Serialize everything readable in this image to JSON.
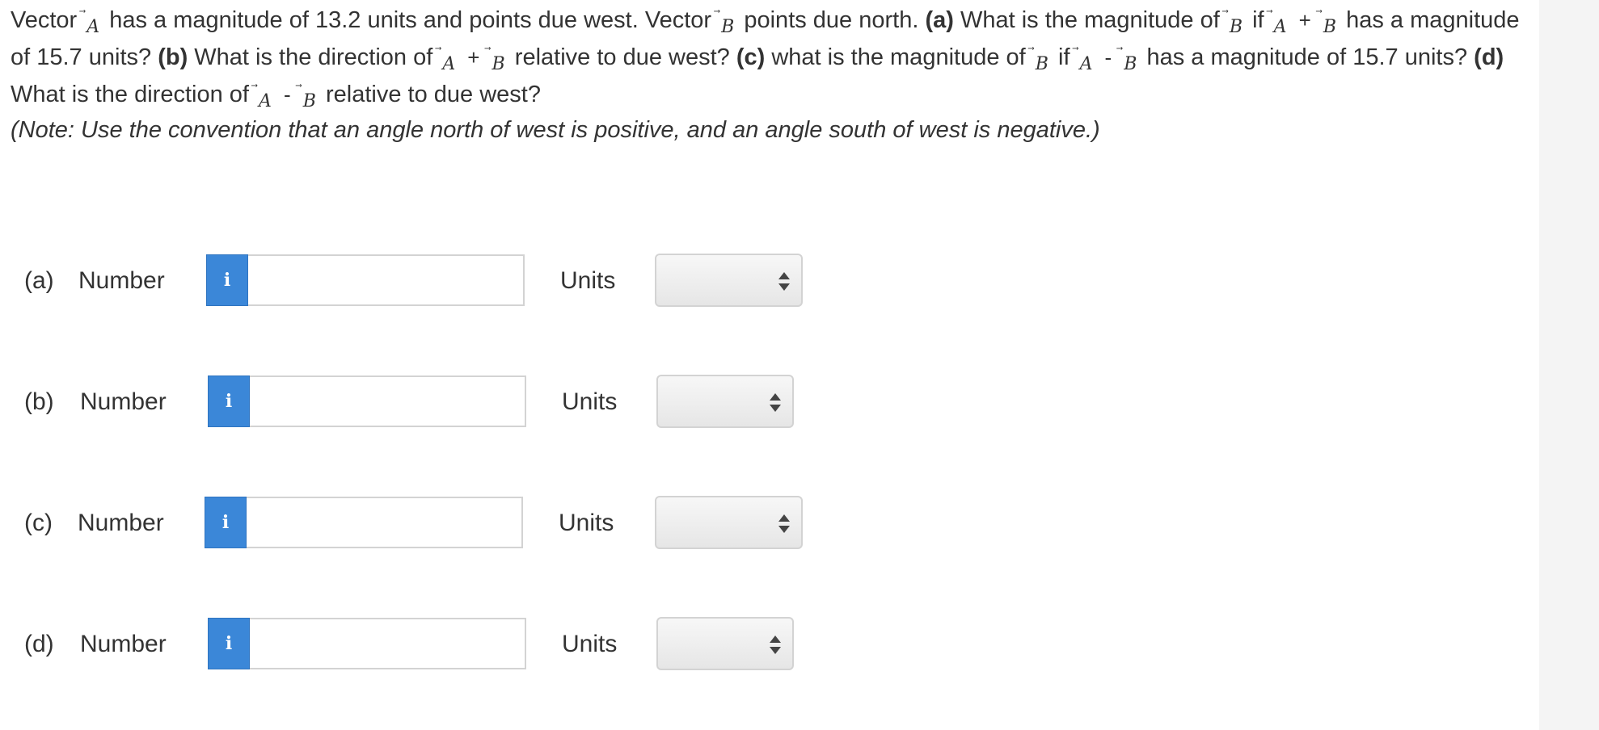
{
  "question": {
    "s1": "Vector",
    "s2": "has a magnitude of 13.2 units and points due west. Vector",
    "s3": "points due north.",
    "a_tag": "(a)",
    "a_text": "What is the magnitude of",
    "if_word": "if",
    "plus": "+",
    "has_a": "has a magnitude of 15.7 units?",
    "b_tag": "(b)",
    "b_text": "What is the direction of",
    "relative_west": "relative to due west?",
    "c_tag": "(c)",
    "c_text": "what is the magnitude of",
    "if_word_2": "if",
    "minus": "-",
    "has_a_2": "has a magnitude of 15.7 units?",
    "d_tag": "(d)",
    "d_text": "What is the direction of",
    "minus_2": "-",
    "relative_west_2": "relative to due west?",
    "vector_a": "A",
    "vector_b": "B",
    "arrow": "⃗"
  },
  "note": "(Note: Use the convention that an angle north of west is positive, and an angle south of west is negative.)",
  "parts": [
    {
      "tag": "(a)",
      "label": "Number",
      "info_icon": "i",
      "value": "",
      "units_label": "Units",
      "units_value": ""
    },
    {
      "tag": "(b)",
      "label": "Number",
      "info_icon": "i",
      "value": "",
      "units_label": "Units",
      "units_value": ""
    },
    {
      "tag": "(c)",
      "label": "Number",
      "info_icon": "i",
      "value": "",
      "units_label": "Units",
      "units_value": ""
    },
    {
      "tag": "(d)",
      "label": "Number",
      "info_icon": "i",
      "value": "",
      "units_label": "Units",
      "units_value": ""
    }
  ],
  "icons": {
    "info": "info-icon",
    "select_arrows": "up-down-arrows-icon"
  },
  "colors": {
    "info_button": "#3b87d8",
    "text": "#333333",
    "input_border": "#d3d3d3"
  }
}
